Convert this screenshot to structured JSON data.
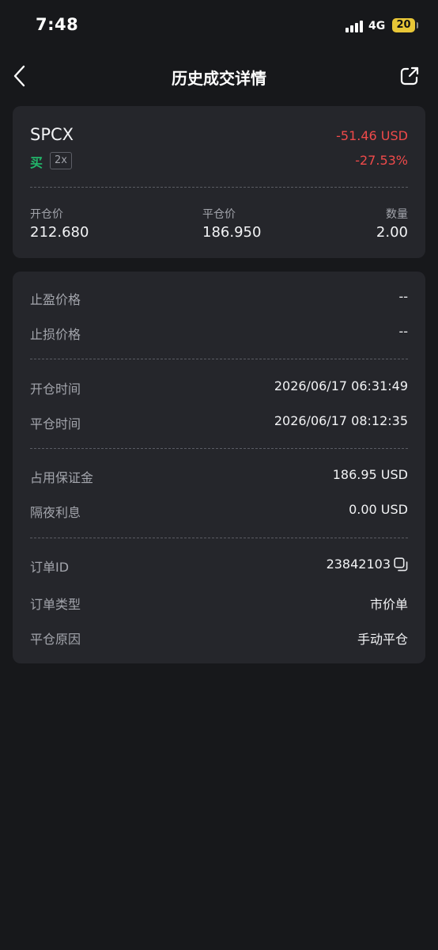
{
  "status_bar": {
    "time": "7:48",
    "network": "4G",
    "battery": "20"
  },
  "nav": {
    "title": "历史成交详情",
    "back_icon": "chevron-left-icon",
    "share_icon": "share-external-icon"
  },
  "summary": {
    "symbol": "SPCX",
    "side": "买",
    "leverage": "2x",
    "pnl_amount": "-51.46 USD",
    "pnl_percent": "-27.53%",
    "metrics": [
      {
        "label": "开仓价",
        "value": "212.680"
      },
      {
        "label": "平仓价",
        "value": "186.950"
      },
      {
        "label": "数量",
        "value": "2.00"
      }
    ]
  },
  "details": {
    "take_profit": {
      "label": "止盈价格",
      "value": "--"
    },
    "stop_loss": {
      "label": "止损价格",
      "value": "--"
    },
    "open_time": {
      "label": "开仓时间",
      "value": "2026/06/17 06:31:49"
    },
    "close_time": {
      "label": "平仓时间",
      "value": "2026/06/17 08:12:35"
    },
    "margin": {
      "label": "占用保证金",
      "value": "186.95 USD"
    },
    "overnight_interest": {
      "label": "隔夜利息",
      "value": "0.00 USD"
    },
    "order_id": {
      "label": "订单ID",
      "value": "23842103"
    },
    "order_type": {
      "label": "订单类型",
      "value": "市价单"
    },
    "close_reason": {
      "label": "平仓原因",
      "value": "手动平仓"
    }
  },
  "colors": {
    "background": "#17181b",
    "card": "#25262b",
    "loss": "#ef4a4a",
    "buy": "#22b86b",
    "battery": "#e8c637"
  }
}
